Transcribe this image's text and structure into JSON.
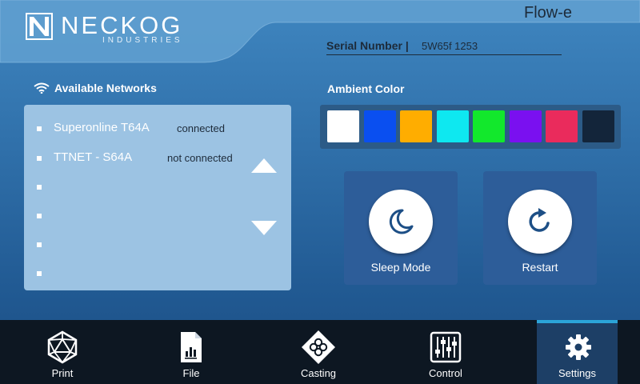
{
  "header": {
    "logo_name": "NECKOG",
    "logo_sub": "INDUSTRIES",
    "brand": "Flow-e",
    "serial_label": "Serial Number |",
    "serial_value": "5W65f 1253"
  },
  "networks": {
    "title": "Available Networks",
    "items": [
      {
        "name": "Superonline T64A",
        "status": "connected"
      },
      {
        "name": "TTNET - S64A",
        "status": "not connected"
      },
      {
        "name": "",
        "status": ""
      },
      {
        "name": "",
        "status": ""
      },
      {
        "name": "",
        "status": ""
      },
      {
        "name": "",
        "status": ""
      }
    ]
  },
  "ambient": {
    "title": "Ambient Color",
    "colors": [
      "#ffffff",
      "#0a4ff0",
      "#ffad00",
      "#0ee8f0",
      "#12e82c",
      "#7a10f0",
      "#ea2b5c",
      "#13253a"
    ]
  },
  "actions": {
    "sleep_label": "Sleep Mode",
    "restart_label": "Restart"
  },
  "nav": {
    "items": [
      {
        "label": "Print",
        "icon": "d20-icon"
      },
      {
        "label": "File",
        "icon": "file-chart-icon"
      },
      {
        "label": "Casting",
        "icon": "casting-icon"
      },
      {
        "label": "Control",
        "icon": "sliders-icon"
      },
      {
        "label": "Settings",
        "icon": "gear-icon"
      }
    ],
    "active": "Settings"
  }
}
